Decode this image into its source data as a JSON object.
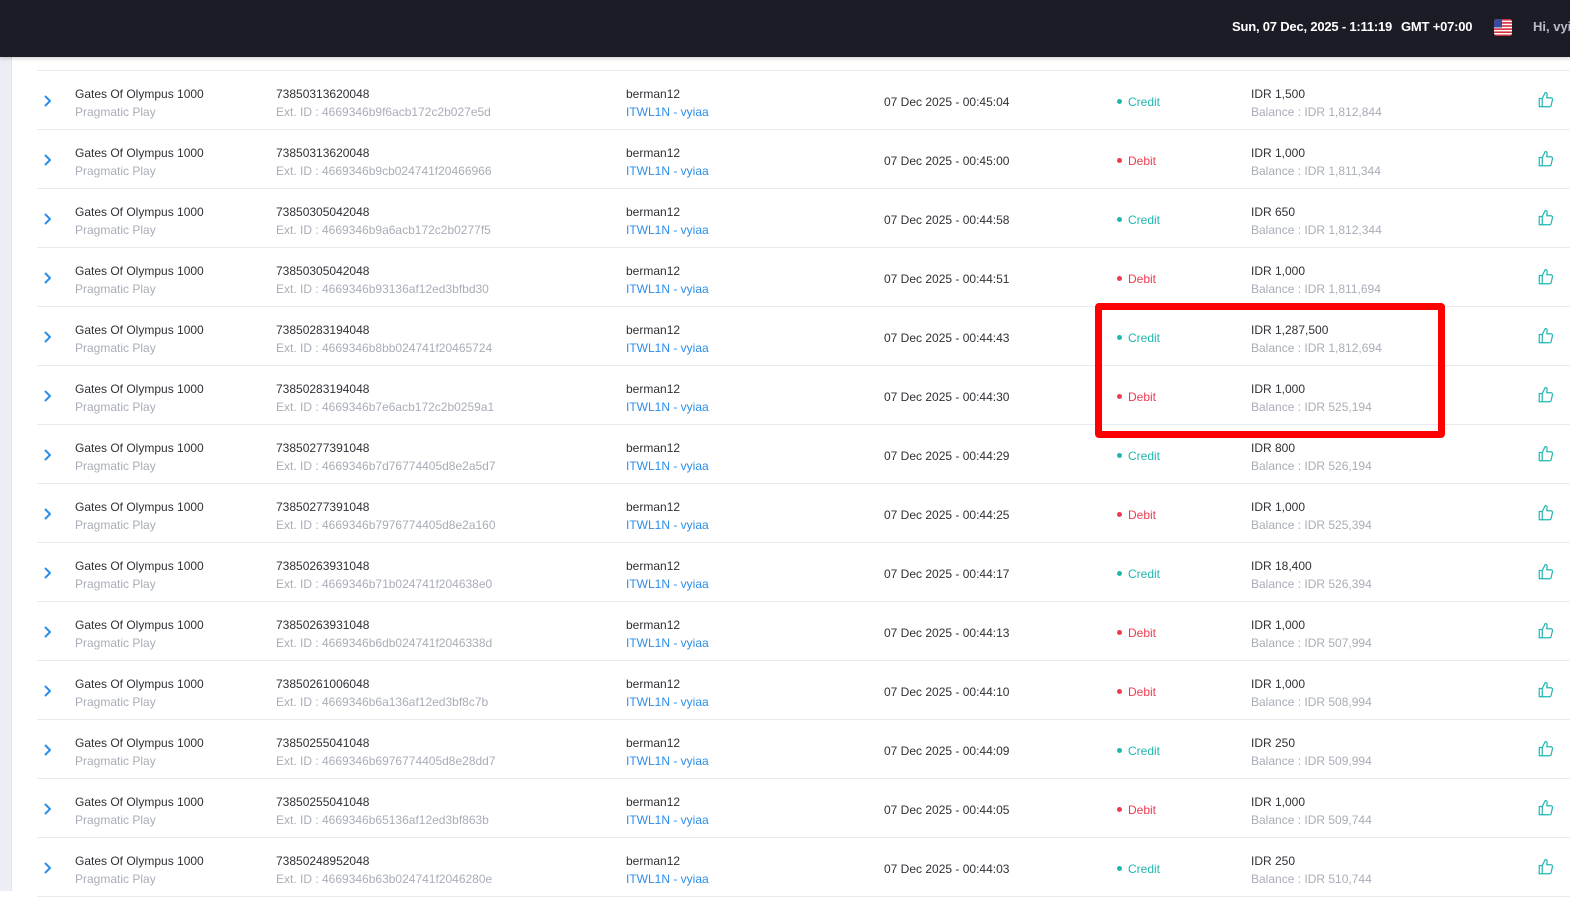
{
  "header": {
    "datetime": "Sun, 07 Dec, 2025 - 1:11:19",
    "timezone": "GMT +07:00",
    "flag_icon": "us-flag-icon",
    "greeting": "Hi, vyi"
  },
  "colors": {
    "topbar": "#1b1c26",
    "credit": "#1fb7b0",
    "debit": "#ef3b4f",
    "link": "#2d8ee8",
    "highlight": "#ff0000"
  },
  "rows": [
    {
      "game": "Gates Of Olympus 1000",
      "provider": "Pragmatic Play",
      "txn_id": "73850313620048",
      "ext_id": "Ext. ID : 4669346b9f6acb172c2b027e5d",
      "user": "berman12",
      "agent": "ITWL1N - vyiaa",
      "date": "07 Dec 2025 - 00:45:04",
      "type": "Credit",
      "amount": "IDR 1,500",
      "balance": "Balance : IDR 1,812,844"
    },
    {
      "game": "Gates Of Olympus 1000",
      "provider": "Pragmatic Play",
      "txn_id": "73850313620048",
      "ext_id": "Ext. ID : 4669346b9cb024741f20466966",
      "user": "berman12",
      "agent": "ITWL1N - vyiaa",
      "date": "07 Dec 2025 - 00:45:00",
      "type": "Debit",
      "amount": "IDR 1,000",
      "balance": "Balance : IDR 1,811,344"
    },
    {
      "game": "Gates Of Olympus 1000",
      "provider": "Pragmatic Play",
      "txn_id": "73850305042048",
      "ext_id": "Ext. ID : 4669346b9a6acb172c2b0277f5",
      "user": "berman12",
      "agent": "ITWL1N - vyiaa",
      "date": "07 Dec 2025 - 00:44:58",
      "type": "Credit",
      "amount": "IDR 650",
      "balance": "Balance : IDR 1,812,344"
    },
    {
      "game": "Gates Of Olympus 1000",
      "provider": "Pragmatic Play",
      "txn_id": "73850305042048",
      "ext_id": "Ext. ID : 4669346b93136af12ed3bfbd30",
      "user": "berman12",
      "agent": "ITWL1N - vyiaa",
      "date": "07 Dec 2025 - 00:44:51",
      "type": "Debit",
      "amount": "IDR 1,000",
      "balance": "Balance : IDR 1,811,694"
    },
    {
      "game": "Gates Of Olympus 1000",
      "provider": "Pragmatic Play",
      "txn_id": "73850283194048",
      "ext_id": "Ext. ID : 4669346b8bb024741f20465724",
      "user": "berman12",
      "agent": "ITWL1N - vyiaa",
      "date": "07 Dec 2025 - 00:44:43",
      "type": "Credit",
      "amount": "IDR 1,287,500",
      "balance": "Balance : IDR 1,812,694"
    },
    {
      "game": "Gates Of Olympus 1000",
      "provider": "Pragmatic Play",
      "txn_id": "73850283194048",
      "ext_id": "Ext. ID : 4669346b7e6acb172c2b0259a1",
      "user": "berman12",
      "agent": "ITWL1N - vyiaa",
      "date": "07 Dec 2025 - 00:44:30",
      "type": "Debit",
      "amount": "IDR 1,000",
      "balance": "Balance : IDR 525,194"
    },
    {
      "game": "Gates Of Olympus 1000",
      "provider": "Pragmatic Play",
      "txn_id": "73850277391048",
      "ext_id": "Ext. ID : 4669346b7d76774405d8e2a5d7",
      "user": "berman12",
      "agent": "ITWL1N - vyiaa",
      "date": "07 Dec 2025 - 00:44:29",
      "type": "Credit",
      "amount": "IDR 800",
      "balance": "Balance : IDR 526,194"
    },
    {
      "game": "Gates Of Olympus 1000",
      "provider": "Pragmatic Play",
      "txn_id": "73850277391048",
      "ext_id": "Ext. ID : 4669346b7976774405d8e2a160",
      "user": "berman12",
      "agent": "ITWL1N - vyiaa",
      "date": "07 Dec 2025 - 00:44:25",
      "type": "Debit",
      "amount": "IDR 1,000",
      "balance": "Balance : IDR 525,394"
    },
    {
      "game": "Gates Of Olympus 1000",
      "provider": "Pragmatic Play",
      "txn_id": "73850263931048",
      "ext_id": "Ext. ID : 4669346b71b024741f204638e0",
      "user": "berman12",
      "agent": "ITWL1N - vyiaa",
      "date": "07 Dec 2025 - 00:44:17",
      "type": "Credit",
      "amount": "IDR 18,400",
      "balance": "Balance : IDR 526,394"
    },
    {
      "game": "Gates Of Olympus 1000",
      "provider": "Pragmatic Play",
      "txn_id": "73850263931048",
      "ext_id": "Ext. ID : 4669346b6db024741f2046338d",
      "user": "berman12",
      "agent": "ITWL1N - vyiaa",
      "date": "07 Dec 2025 - 00:44:13",
      "type": "Debit",
      "amount": "IDR 1,000",
      "balance": "Balance : IDR 507,994"
    },
    {
      "game": "Gates Of Olympus 1000",
      "provider": "Pragmatic Play",
      "txn_id": "73850261006048",
      "ext_id": "Ext. ID : 4669346b6a136af12ed3bf8c7b",
      "user": "berman12",
      "agent": "ITWL1N - vyiaa",
      "date": "07 Dec 2025 - 00:44:10",
      "type": "Debit",
      "amount": "IDR 1,000",
      "balance": "Balance : IDR 508,994"
    },
    {
      "game": "Gates Of Olympus 1000",
      "provider": "Pragmatic Play",
      "txn_id": "73850255041048",
      "ext_id": "Ext. ID : 4669346b6976774405d8e28dd7",
      "user": "berman12",
      "agent": "ITWL1N - vyiaa",
      "date": "07 Dec 2025 - 00:44:09",
      "type": "Credit",
      "amount": "IDR 250",
      "balance": "Balance : IDR 509,994"
    },
    {
      "game": "Gates Of Olympus 1000",
      "provider": "Pragmatic Play",
      "txn_id": "73850255041048",
      "ext_id": "Ext. ID : 4669346b65136af12ed3bf863b",
      "user": "berman12",
      "agent": "ITWL1N - vyiaa",
      "date": "07 Dec 2025 - 00:44:05",
      "type": "Debit",
      "amount": "IDR 1,000",
      "balance": "Balance : IDR 509,744"
    },
    {
      "game": "Gates Of Olympus 1000",
      "provider": "Pragmatic Play",
      "txn_id": "73850248952048",
      "ext_id": "Ext. ID : 4669346b63b024741f2046280e",
      "user": "berman12",
      "agent": "ITWL1N - vyiaa",
      "date": "07 Dec 2025 - 00:44:03",
      "type": "Credit",
      "amount": "IDR 250",
      "balance": "Balance : IDR 510,744"
    }
  ]
}
